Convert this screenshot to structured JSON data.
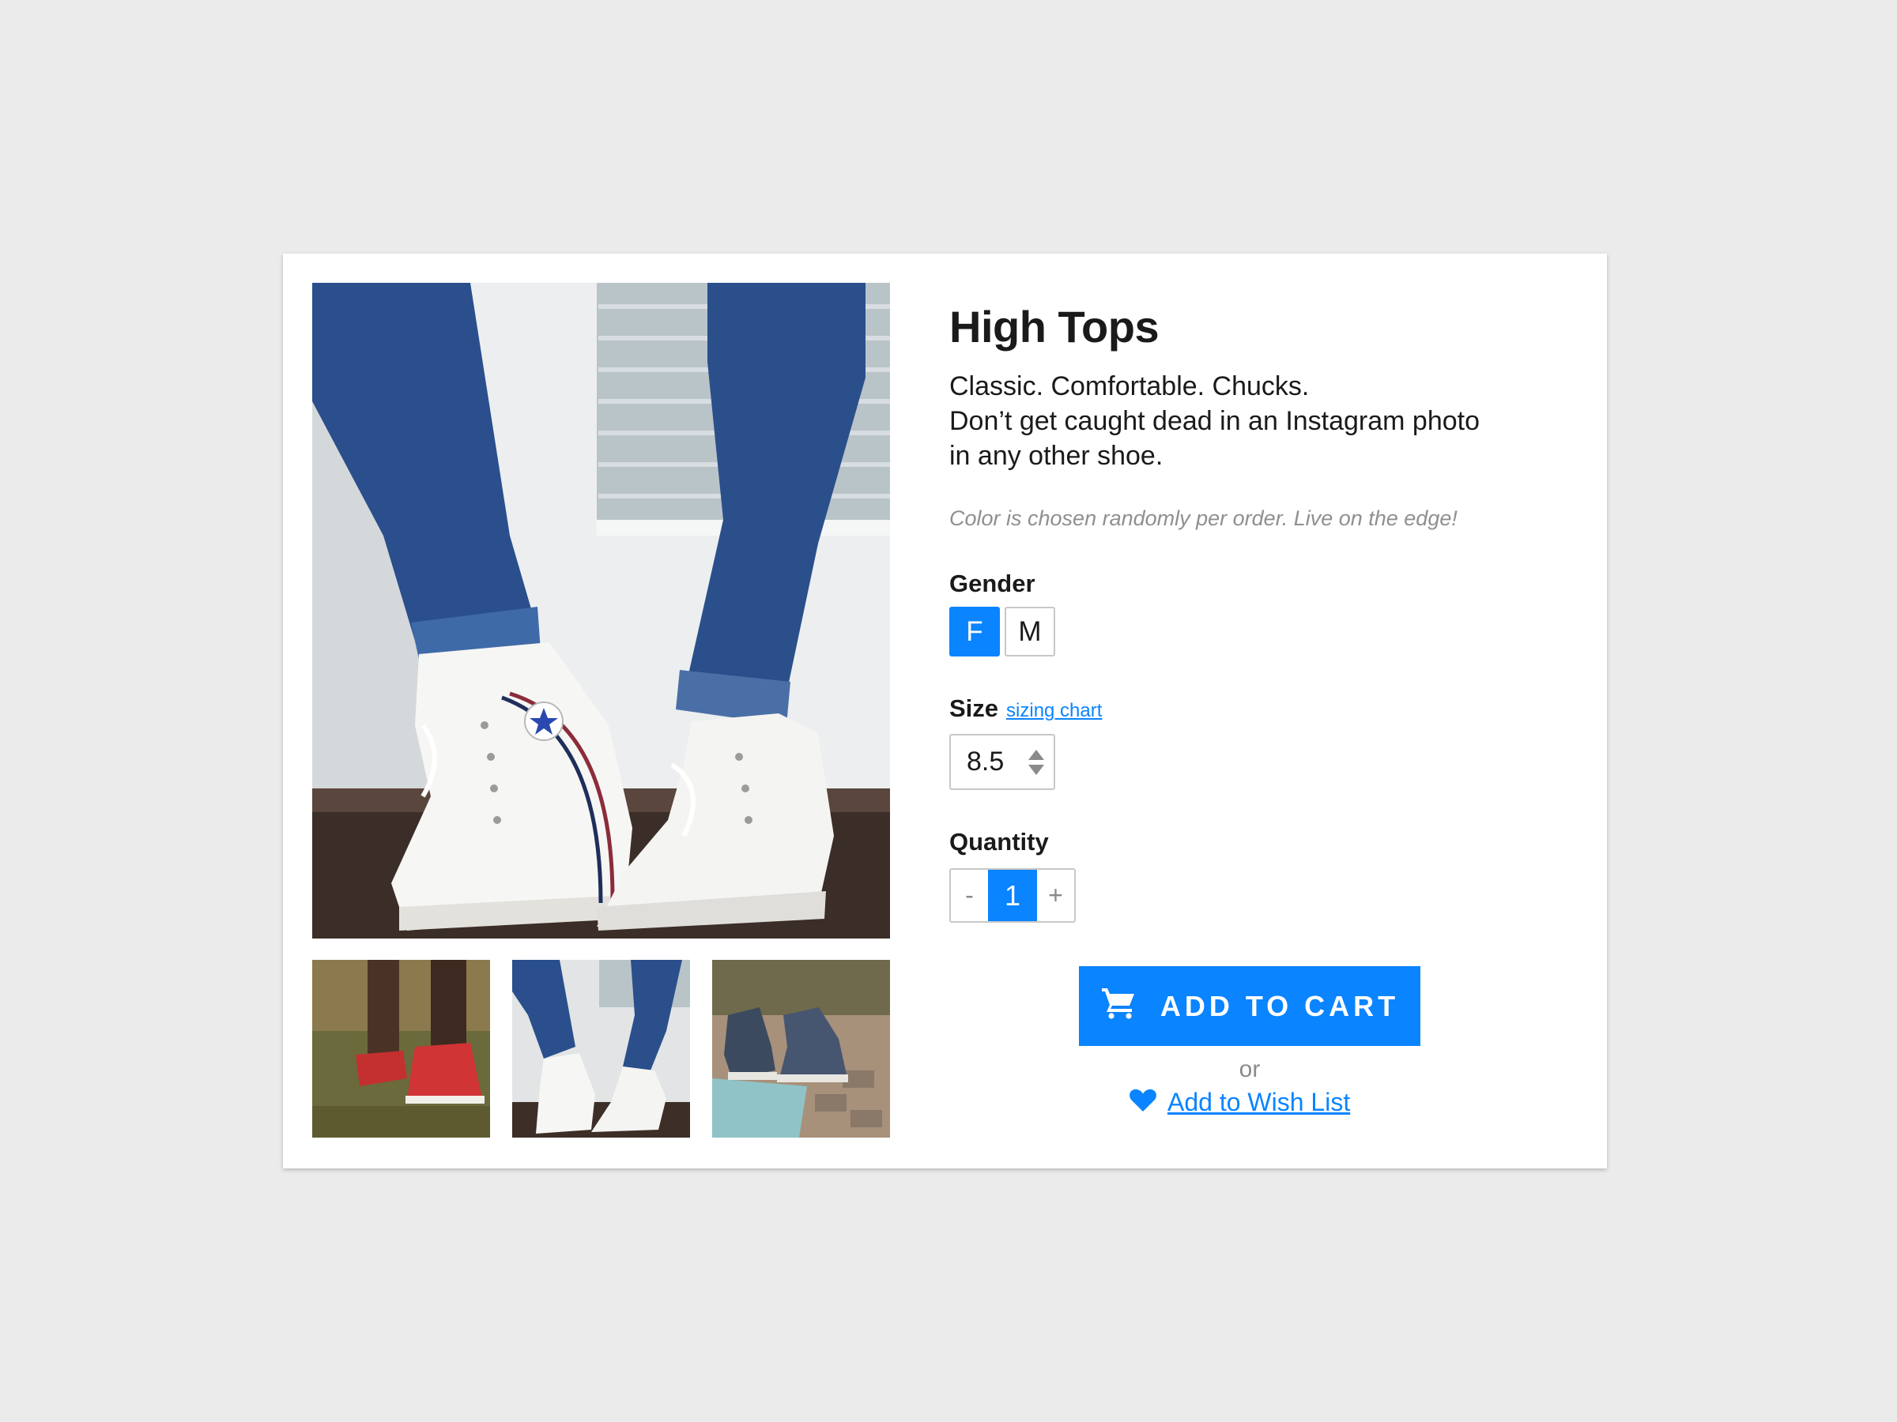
{
  "product": {
    "title": "High Tops",
    "description_lines": [
      "Classic. Comfortable. Chucks.",
      "Don’t get caught dead in an Instagram photo",
      "in any other shoe."
    ],
    "note": "Color is chosen randomly per order. Live on the edge!"
  },
  "gender": {
    "label": "Gender",
    "options": [
      "F",
      "M"
    ],
    "selected": "F"
  },
  "size": {
    "label": "Size",
    "chart_link": "sizing chart",
    "value": "8.5"
  },
  "quantity": {
    "label": "Quantity",
    "decrement": "-",
    "value": "1",
    "increment": "+"
  },
  "actions": {
    "add_to_cart": "ADD TO CART",
    "or": "or",
    "wish_list": "Add to Wish List"
  },
  "colors": {
    "accent": "#0a84ff",
    "muted_text": "#8f8f8f",
    "page_bg": "#ebebeb"
  },
  "icons": {
    "cart": "cart-icon",
    "heart": "heart-icon",
    "size_arrows": "up-down-arrows-icon"
  }
}
